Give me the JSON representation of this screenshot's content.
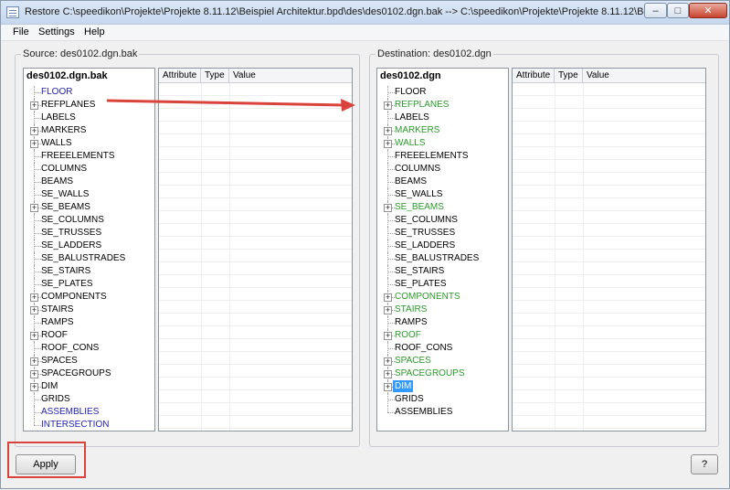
{
  "window": {
    "title": "Restore C:\\speedikon\\Projekte\\Projekte 8.11.12\\Beispiel Architektur.bpd\\des\\des0102.dgn.bak --> C:\\speedikon\\Projekte\\Projekte 8.11.12\\Beisp...",
    "minimize": "–",
    "maximize": "□",
    "close": "✕"
  },
  "menu": [
    "File",
    "Settings",
    "Help"
  ],
  "source": {
    "label": "Source: des0102.dgn.bak",
    "root": "des0102.dgn.bak",
    "nodes": [
      {
        "label": "FLOOR",
        "expand": false,
        "color": "#1f1fb0"
      },
      {
        "label": "REFPLANES",
        "expand": true,
        "color": "#000000"
      },
      {
        "label": "LABELS",
        "expand": false,
        "color": "#000000"
      },
      {
        "label": "MARKERS",
        "expand": true,
        "color": "#000000"
      },
      {
        "label": "WALLS",
        "expand": true,
        "color": "#000000"
      },
      {
        "label": "FREEELEMENTS",
        "expand": false,
        "color": "#000000"
      },
      {
        "label": "COLUMNS",
        "expand": false,
        "color": "#000000"
      },
      {
        "label": "BEAMS",
        "expand": false,
        "color": "#000000"
      },
      {
        "label": "SE_WALLS",
        "expand": false,
        "color": "#000000"
      },
      {
        "label": "SE_BEAMS",
        "expand": true,
        "color": "#000000"
      },
      {
        "label": "SE_COLUMNS",
        "expand": false,
        "color": "#000000"
      },
      {
        "label": "SE_TRUSSES",
        "expand": false,
        "color": "#000000"
      },
      {
        "label": "SE_LADDERS",
        "expand": false,
        "color": "#000000"
      },
      {
        "label": "SE_BALUSTRADES",
        "expand": false,
        "color": "#000000"
      },
      {
        "label": "SE_STAIRS",
        "expand": false,
        "color": "#000000"
      },
      {
        "label": "SE_PLATES",
        "expand": false,
        "color": "#000000"
      },
      {
        "label": "COMPONENTS",
        "expand": true,
        "color": "#000000"
      },
      {
        "label": "STAIRS",
        "expand": true,
        "color": "#000000"
      },
      {
        "label": "RAMPS",
        "expand": false,
        "color": "#000000"
      },
      {
        "label": "ROOF",
        "expand": true,
        "color": "#000000"
      },
      {
        "label": "ROOF_CONS",
        "expand": false,
        "color": "#000000"
      },
      {
        "label": "SPACES",
        "expand": true,
        "color": "#000000"
      },
      {
        "label": "SPACEGROUPS",
        "expand": true,
        "color": "#000000"
      },
      {
        "label": "DIM",
        "expand": true,
        "color": "#000000"
      },
      {
        "label": "GRIDS",
        "expand": false,
        "color": "#000000"
      },
      {
        "label": "ASSEMBLIES",
        "expand": false,
        "color": "#1f1fb0"
      },
      {
        "label": "INTERSECTION",
        "expand": false,
        "color": "#1f1fb0"
      }
    ],
    "columns": [
      "Attribute",
      "Type",
      "Value"
    ]
  },
  "destination": {
    "label": "Destination: des0102.dgn",
    "root": "des0102.dgn",
    "nodes": [
      {
        "label": "FLOOR",
        "expand": false,
        "color": "#000000"
      },
      {
        "label": "REFPLANES",
        "expand": true,
        "color": "#2a9a2a"
      },
      {
        "label": "LABELS",
        "expand": false,
        "color": "#000000"
      },
      {
        "label": "MARKERS",
        "expand": true,
        "color": "#2a9a2a"
      },
      {
        "label": "WALLS",
        "expand": true,
        "color": "#2a9a2a"
      },
      {
        "label": "FREEELEMENTS",
        "expand": false,
        "color": "#000000"
      },
      {
        "label": "COLUMNS",
        "expand": false,
        "color": "#000000"
      },
      {
        "label": "BEAMS",
        "expand": false,
        "color": "#000000"
      },
      {
        "label": "SE_WALLS",
        "expand": false,
        "color": "#000000"
      },
      {
        "label": "SE_BEAMS",
        "expand": true,
        "color": "#2a9a2a"
      },
      {
        "label": "SE_COLUMNS",
        "expand": false,
        "color": "#000000"
      },
      {
        "label": "SE_TRUSSES",
        "expand": false,
        "color": "#000000"
      },
      {
        "label": "SE_LADDERS",
        "expand": false,
        "color": "#000000"
      },
      {
        "label": "SE_BALUSTRADES",
        "expand": false,
        "color": "#000000"
      },
      {
        "label": "SE_STAIRS",
        "expand": false,
        "color": "#000000"
      },
      {
        "label": "SE_PLATES",
        "expand": false,
        "color": "#000000"
      },
      {
        "label": "COMPONENTS",
        "expand": true,
        "color": "#2a9a2a"
      },
      {
        "label": "STAIRS",
        "expand": true,
        "color": "#2a9a2a"
      },
      {
        "label": "RAMPS",
        "expand": false,
        "color": "#000000"
      },
      {
        "label": "ROOF",
        "expand": true,
        "color": "#2a9a2a"
      },
      {
        "label": "ROOF_CONS",
        "expand": false,
        "color": "#000000"
      },
      {
        "label": "SPACES",
        "expand": true,
        "color": "#2a9a2a"
      },
      {
        "label": "SPACEGROUPS",
        "expand": true,
        "color": "#2a9a2a"
      },
      {
        "label": "DIM",
        "expand": true,
        "color": "#000000",
        "selected": true
      },
      {
        "label": "GRIDS",
        "expand": false,
        "color": "#000000"
      },
      {
        "label": "ASSEMBLIES",
        "expand": false,
        "color": "#000000"
      }
    ],
    "columns": [
      "Attribute",
      "Type",
      "Value"
    ]
  },
  "buttons": {
    "apply": "Apply",
    "help": "?"
  },
  "colors": {
    "selection": "#3399ff",
    "highlight_outline": "#d9433b",
    "arrow": "#d9433b"
  }
}
